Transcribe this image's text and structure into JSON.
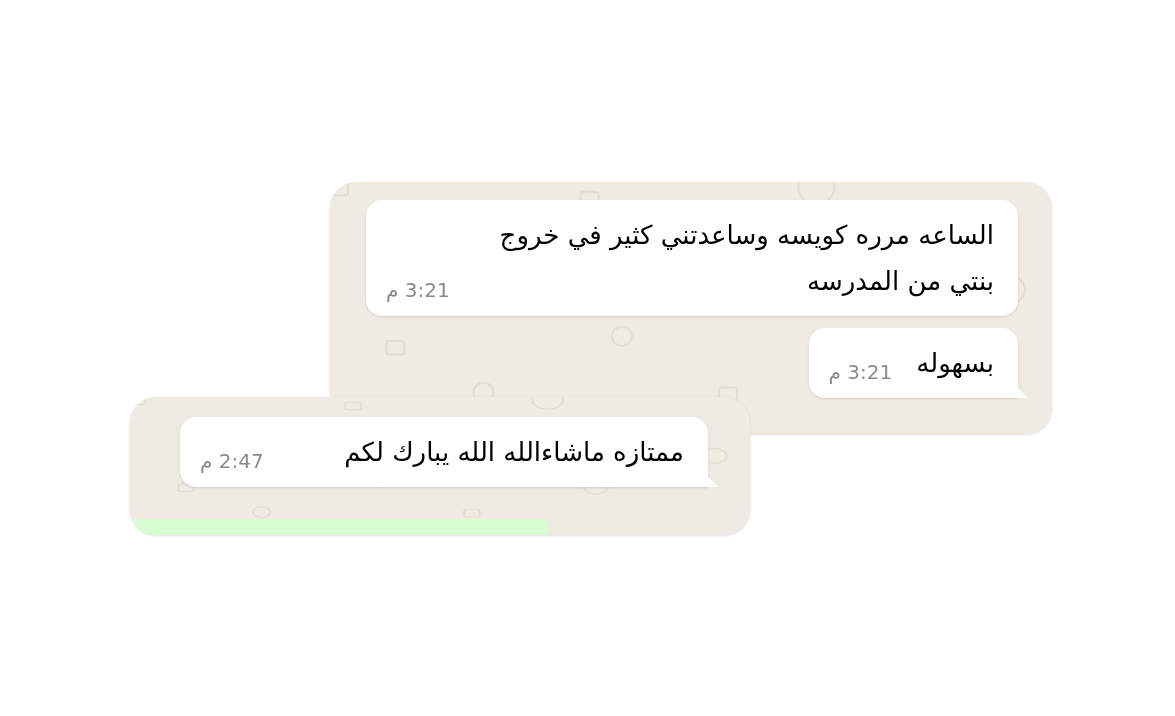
{
  "cards": [
    {
      "messages": [
        {
          "text": "الساعه مرره كويسه وساعدتني كثير في خروج بنتي من المدرسه",
          "time": "3:21 م",
          "tail": false
        },
        {
          "text": "بسهوله",
          "time": "3:21 م",
          "tail": true
        }
      ]
    },
    {
      "messages": [
        {
          "text": "ممتازه ماشاءالله الله يبارك لكم",
          "time": "2:47 م",
          "tail": true
        }
      ]
    }
  ]
}
